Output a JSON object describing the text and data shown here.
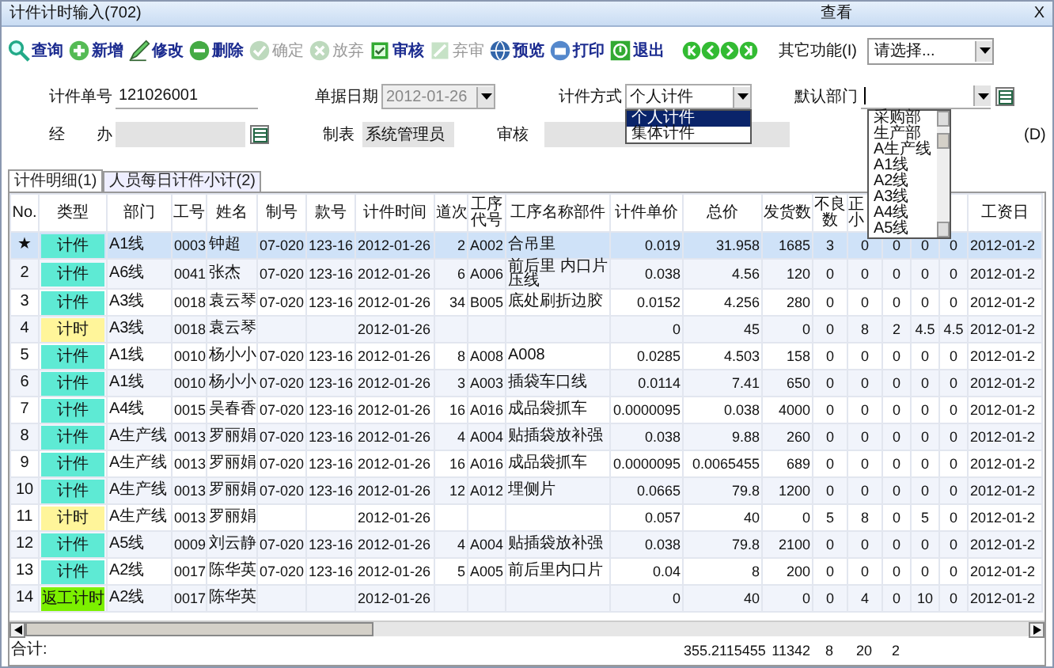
{
  "window": {
    "title": "计件计时输入(702)",
    "view_label": "查看",
    "close": "X"
  },
  "toolbar": {
    "buttons": [
      {
        "label": "查询",
        "disabled": false
      },
      {
        "label": "新增",
        "disabled": false
      },
      {
        "label": "修改",
        "disabled": false
      },
      {
        "label": "删除",
        "disabled": false
      },
      {
        "label": "确定",
        "disabled": true
      },
      {
        "label": "放弃",
        "disabled": true
      },
      {
        "label": "审核",
        "disabled": false
      },
      {
        "label": "弃审",
        "disabled": true
      },
      {
        "label": "预览",
        "disabled": false
      },
      {
        "label": "打印",
        "disabled": false
      },
      {
        "label": "退出",
        "disabled": false
      }
    ],
    "other_label": "其它功能(I)",
    "other_select": "请选择..."
  },
  "form": {
    "order_no": {
      "label": "计件单号",
      "value": "121026001"
    },
    "doc_date": {
      "label": "单据日期",
      "value": "2012-01-26",
      "disabled": true
    },
    "method": {
      "label": "计件方式",
      "value": "个人计件",
      "expanded": true,
      "options": [
        {
          "label": "个人计件",
          "selected": true
        },
        {
          "label": "集体计件",
          "selected": false
        }
      ]
    },
    "default_dept": {
      "label": "默认部门",
      "focused": true,
      "expanded": true,
      "options": [
        "采购部",
        "生产部",
        "A生产线",
        "A1线",
        "A2线",
        "A3线",
        "A4线",
        "A5线"
      ]
    },
    "handler": {
      "label": "经　　办"
    },
    "maker": {
      "label": "制表",
      "value": "系统管理员"
    },
    "reviewer": {
      "label": "审核"
    },
    "hidden_label": "(D)"
  },
  "tabs": [
    {
      "label": "计件明细(1)",
      "selected": true
    },
    {
      "label": "人员每日计件小计(2)",
      "selected": false
    }
  ],
  "table": {
    "columns": [
      "No.",
      "类型",
      "部门",
      "工号",
      "姓名",
      "制号",
      "款号",
      "计件时间",
      "道次",
      "工序代号",
      "工序名称部件",
      "计件单价",
      "总价",
      "发货数",
      "不良数",
      "正小",
      "",
      "",
      "",
      "工资日"
    ],
    "rows": [
      {
        "selected": true,
        "color": "#5eead4",
        "cells": [
          "★",
          "计件",
          "A1线",
          "0003",
          "钟超",
          "07-020",
          "123-16",
          "2012-01-26",
          "2",
          "A002",
          "合吊里",
          "0.019",
          "31.958",
          "1685",
          "3",
          "0",
          "0",
          "0",
          "0",
          "2012-01-2"
        ]
      },
      {
        "selected": false,
        "color": "#5eead4",
        "cells": [
          "2",
          "计件",
          "A6线",
          "0041",
          "张杰",
          "07-020",
          "123-16",
          "2012-01-26",
          "6",
          "A006",
          "前后里 内口片压线",
          "0.038",
          "4.56",
          "120",
          "0",
          "0",
          "0",
          "0",
          "0",
          "2012-01-2"
        ]
      },
      {
        "selected": false,
        "color": "#5eead4",
        "cells": [
          "3",
          "计件",
          "A3线",
          "0018",
          "袁云琴",
          "07-020",
          "123-16",
          "2012-01-26",
          "34",
          "B005",
          "底处刷折边胶",
          "0.0152",
          "4.256",
          "280",
          "0",
          "0",
          "0",
          "0",
          "0",
          "2012-01-2"
        ]
      },
      {
        "selected": false,
        "color": "#fff59a",
        "cells": [
          "4",
          "计时",
          "A3线",
          "0018",
          "袁云琴",
          "",
          "",
          "2012-01-26",
          "",
          "",
          "",
          "0",
          "45",
          "0",
          "0",
          "8",
          "2",
          "4.5",
          "4.5",
          "2012-01-2"
        ]
      },
      {
        "selected": false,
        "color": "#5eead4",
        "cells": [
          "5",
          "计件",
          "A1线",
          "0010",
          "杨小小",
          "07-020",
          "123-16",
          "2012-01-26",
          "8",
          "A008",
          "A008",
          "0.0285",
          "4.503",
          "158",
          "0",
          "0",
          "0",
          "0",
          "0",
          "2012-01-2"
        ]
      },
      {
        "selected": false,
        "color": "#5eead4",
        "cells": [
          "6",
          "计件",
          "A1线",
          "0010",
          "杨小小",
          "07-020",
          "123-16",
          "2012-01-26",
          "3",
          "A003",
          "插袋车口线",
          "0.0114",
          "7.41",
          "650",
          "0",
          "0",
          "0",
          "0",
          "0",
          "2012-01-2"
        ]
      },
      {
        "selected": false,
        "color": "#5eead4",
        "cells": [
          "7",
          "计件",
          "A4线",
          "0015",
          "吴春香",
          "07-020",
          "123-16",
          "2012-01-26",
          "16",
          "A016",
          "成品袋抓车",
          "0.0000095",
          "0.038",
          "4000",
          "0",
          "0",
          "0",
          "0",
          "0",
          "2012-01-2"
        ]
      },
      {
        "selected": false,
        "color": "#5eead4",
        "cells": [
          "8",
          "计件",
          "A生产线",
          "0013",
          "罗丽娟",
          "07-020",
          "123-16",
          "2012-01-26",
          "4",
          "A004",
          "贴插袋放补强",
          "0.038",
          "9.88",
          "260",
          "0",
          "0",
          "0",
          "0",
          "0",
          "2012-01-2"
        ]
      },
      {
        "selected": false,
        "color": "#5eead4",
        "cells": [
          "9",
          "计件",
          "A生产线",
          "0013",
          "罗丽娟",
          "07-020",
          "123-16",
          "2012-01-26",
          "16",
          "A016",
          "成品袋抓车",
          "0.0000095",
          "0.0065455",
          "689",
          "0",
          "0",
          "0",
          "0",
          "0",
          "2012-01-2"
        ]
      },
      {
        "selected": false,
        "color": "#5eead4",
        "cells": [
          "10",
          "计件",
          "A生产线",
          "0013",
          "罗丽娟",
          "07-020",
          "123-16",
          "2012-01-26",
          "12",
          "A012",
          "埋侧片",
          "0.0665",
          "79.8",
          "1200",
          "0",
          "0",
          "0",
          "0",
          "0",
          "2012-01-2"
        ]
      },
      {
        "selected": false,
        "color": "#fff59a",
        "cells": [
          "11",
          "计时",
          "A生产线",
          "0013",
          "罗丽娟",
          "",
          "",
          "2012-01-26",
          "",
          "",
          "",
          "0.057",
          "40",
          "0",
          "5",
          "8",
          "0",
          "5",
          "0",
          "2012-01-2"
        ]
      },
      {
        "selected": false,
        "color": "#5eead4",
        "cells": [
          "12",
          "计件",
          "A5线",
          "0009",
          "刘云静",
          "07-020",
          "123-16",
          "2012-01-26",
          "4",
          "A004",
          "贴插袋放补强",
          "0.038",
          "79.8",
          "2100",
          "0",
          "0",
          "0",
          "0",
          "0",
          "2012-01-2"
        ]
      },
      {
        "selected": false,
        "color": "#5eead4",
        "cells": [
          "13",
          "计件",
          "A2线",
          "0017",
          "陈华英",
          "07-020",
          "123-16",
          "2012-01-26",
          "5",
          "A005",
          "前后里内口片",
          "0.04",
          "8",
          "200",
          "0",
          "0",
          "0",
          "0",
          "0",
          "2012-01-2"
        ]
      },
      {
        "selected": false,
        "color": "#7cf000",
        "cells": [
          "14",
          "返工计时",
          "A2线",
          "0017",
          "陈华英",
          "",
          "",
          "2012-01-26",
          "",
          "",
          "",
          "0",
          "40",
          "0",
          "0",
          "4",
          "0",
          "10",
          "0",
          "2012-01-2"
        ]
      }
    ],
    "totals": {
      "label": "合计:",
      "values": [
        "355.2115455",
        "11342",
        "8",
        "20",
        "2"
      ]
    }
  }
}
